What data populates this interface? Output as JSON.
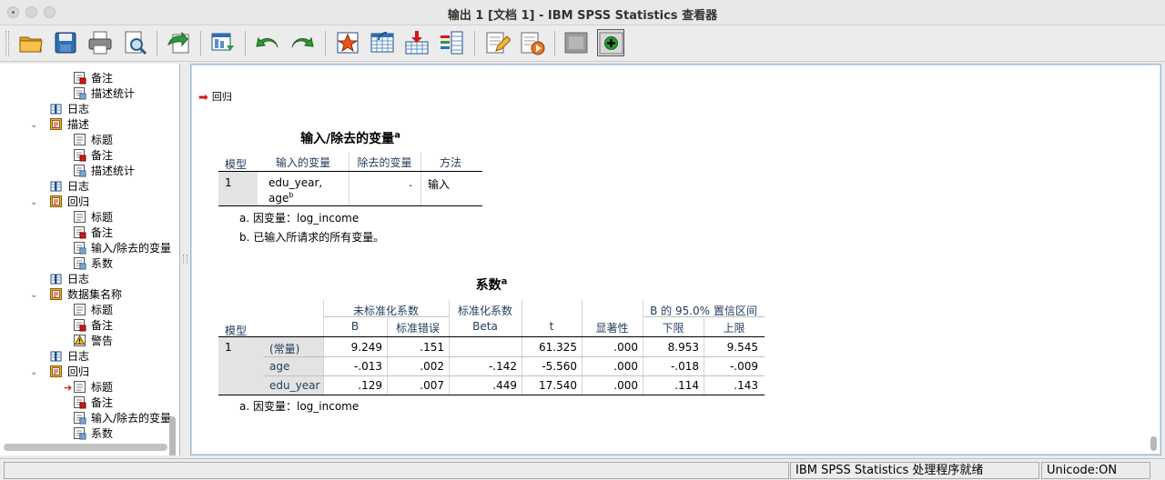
{
  "window": {
    "title": "输出 1 [文档 1] - IBM SPSS Statistics 查看器"
  },
  "toolbar": {
    "buttons": [
      "open-icon",
      "save-icon",
      "print-icon",
      "print-preview-icon",
      "export-icon",
      "goto-data-icon",
      "undo-icon",
      "redo-icon",
      "goto-output-icon",
      "goto-case-icon",
      "insert-variable-icon",
      "variables-icon",
      "edit-output-icon",
      "script-icon",
      "hide-icon",
      "show-icon"
    ]
  },
  "tree": {
    "items": [
      {
        "label": "备注",
        "icon": "notes-icon",
        "level": 2
      },
      {
        "label": "描述统计",
        "icon": "table-icon",
        "level": 2
      },
      {
        "label": "日志",
        "icon": "log-icon",
        "level": 1
      },
      {
        "label": "描述",
        "icon": "folder-icon",
        "level": 1,
        "expanded": true
      },
      {
        "label": "标题",
        "icon": "title-icon",
        "level": 2
      },
      {
        "label": "备注",
        "icon": "notes-icon",
        "level": 2
      },
      {
        "label": "描述统计",
        "icon": "table-icon",
        "level": 2
      },
      {
        "label": "日志",
        "icon": "log-icon",
        "level": 1
      },
      {
        "label": "回归",
        "icon": "folder-icon",
        "level": 1,
        "expanded": true
      },
      {
        "label": "标题",
        "icon": "title-icon",
        "level": 2
      },
      {
        "label": "备注",
        "icon": "notes-icon",
        "level": 2
      },
      {
        "label": "输入/除去的变量",
        "icon": "table-icon",
        "level": 2
      },
      {
        "label": "系数",
        "icon": "table-icon",
        "level": 2
      },
      {
        "label": "日志",
        "icon": "log-icon",
        "level": 1
      },
      {
        "label": "数据集名称",
        "icon": "folder-icon",
        "level": 1,
        "expanded": true
      },
      {
        "label": "标题",
        "icon": "title-icon",
        "level": 2
      },
      {
        "label": "备注",
        "icon": "notes-icon",
        "level": 2
      },
      {
        "label": "警告",
        "icon": "warning-icon",
        "level": 2
      },
      {
        "label": "日志",
        "icon": "log-icon",
        "level": 1
      },
      {
        "label": "回归",
        "icon": "folder-icon",
        "level": 1,
        "expanded": true
      },
      {
        "label": "标题",
        "icon": "title-icon",
        "level": 2,
        "current": true
      },
      {
        "label": "备注",
        "icon": "notes-icon",
        "level": 2
      },
      {
        "label": "输入/除去的变量",
        "icon": "table-icon",
        "level": 2
      },
      {
        "label": "系数",
        "icon": "table-icon",
        "level": 2
      }
    ]
  },
  "output": {
    "heading": "回归",
    "varsTable": {
      "title": "输入/除去的变量",
      "title_sup": "a",
      "headers": {
        "model": "模型",
        "entered": "输入的变量",
        "removed": "除去的变量",
        "method": "方法"
      },
      "row": {
        "model": "1",
        "entered_line1": "edu_year,",
        "entered_line2": "age",
        "entered_sup": "b",
        "removed": ".",
        "method": "输入"
      },
      "notes": [
        "a. 因变量：log_income",
        "b. 已输入所请求的所有变量。"
      ]
    },
    "coefTable": {
      "title": "系数",
      "title_sup": "a",
      "groups": {
        "unstd": "未标准化系数",
        "std": "标准化系数",
        "ci": "B 的 95.0% 置信区间"
      },
      "headers": {
        "model": "模型",
        "b": "B",
        "se": "标准错误",
        "beta": "Beta",
        "t": "t",
        "sig": "显著性",
        "lower": "下限",
        "upper": "上限"
      },
      "model_num": "1",
      "rows": [
        {
          "name": "(常量)",
          "b": "9.249",
          "se": ".151",
          "beta": "",
          "t": "61.325",
          "sig": ".000",
          "lower": "8.953",
          "upper": "9.545"
        },
        {
          "name": "age",
          "b": "-.013",
          "se": ".002",
          "beta": "-.142",
          "t": "-5.560",
          "sig": ".000",
          "lower": "-.018",
          "upper": "-.009"
        },
        {
          "name": "edu_year",
          "b": ".129",
          "se": ".007",
          "beta": ".449",
          "t": "17.540",
          "sig": ".000",
          "lower": ".114",
          "upper": ".143"
        }
      ],
      "notes": [
        "a. 因变量：log_income"
      ]
    }
  },
  "status": {
    "processor": "IBM SPSS Statistics 处理程序就绪",
    "unicode": "Unicode:ON"
  }
}
